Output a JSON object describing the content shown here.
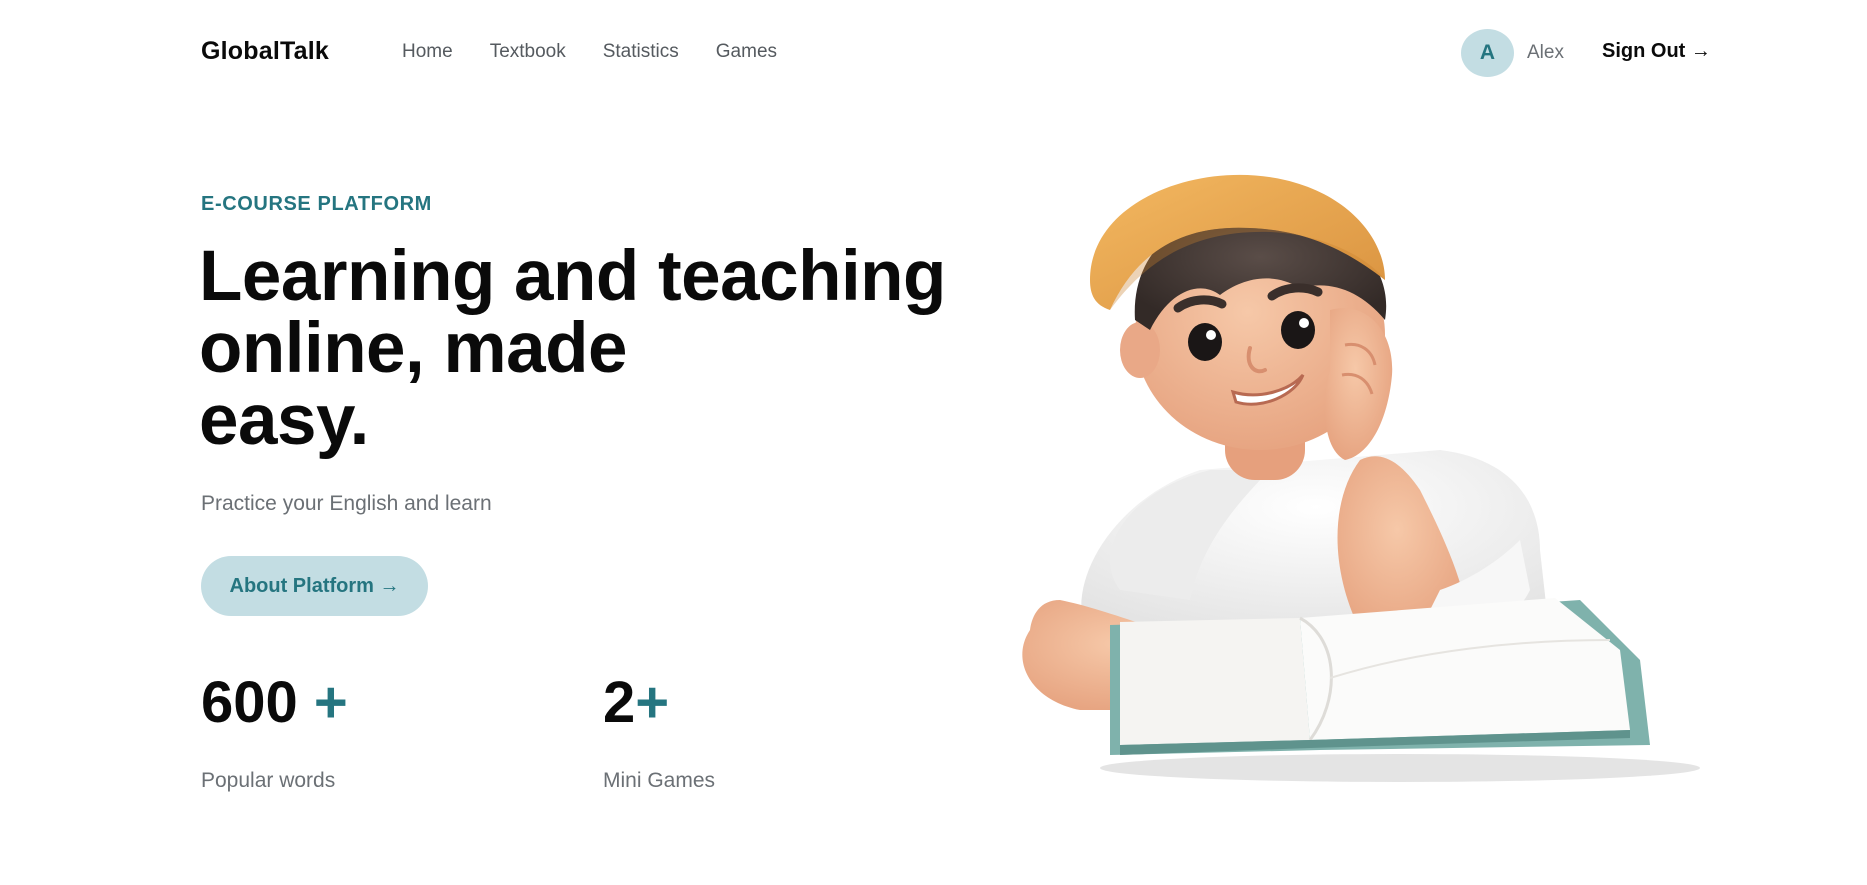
{
  "header": {
    "logo": "GlobalTalk",
    "nav": [
      "Home",
      "Textbook",
      "Statistics",
      "Games"
    ],
    "user": {
      "initial": "A",
      "name": "Alex"
    },
    "signout_label": "Sign Out →"
  },
  "hero": {
    "eyebrow": "E-COURSE PLATFORM",
    "headline_lines": [
      "Learning and teaching",
      "online, made",
      "easy."
    ],
    "subtitle": "Practice your English and learn",
    "cta_label": "About Platform →"
  },
  "stats": [
    {
      "number": "600",
      "suffix": " +",
      "label": "Popular words"
    },
    {
      "number": "2",
      "suffix": "+",
      "label": "Mini Games"
    }
  ],
  "colors": {
    "accent": "#257580",
    "accent_light": "#c3dde3",
    "text": "#0a0a0a",
    "muted": "#6b7075"
  },
  "illustration": {
    "icon": "boy-reading-book-illustration"
  }
}
